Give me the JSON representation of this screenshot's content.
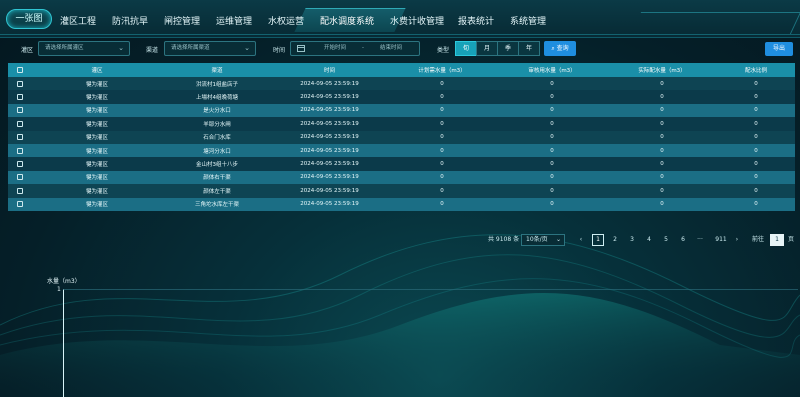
{
  "nav": {
    "home": "一张图",
    "items": [
      "灌区工程",
      "防汛抗旱",
      "闸控管理",
      "运维管理",
      "水权运营",
      "配水调度系统",
      "水费计收管理",
      "报表统计",
      "系统管理"
    ]
  },
  "filters": {
    "district_label": "灌区",
    "district_placeholder": "请选择所属灌区",
    "channel_label": "渠道",
    "channel_placeholder": "请选择所属渠道",
    "time_label": "时间",
    "start_placeholder": "开始时间",
    "range_sep": "-",
    "end_placeholder": "结束时间",
    "type_label": "类型",
    "types": [
      "旬",
      "月",
      "季",
      "年"
    ],
    "query_label": "查询",
    "export_label": "导出"
  },
  "table": {
    "headers": [
      "灌区",
      "渠道",
      "时间",
      "计划需水量（m3）",
      "审核用水量（m3）",
      "实际配水量（m3）",
      "配水比例"
    ],
    "rows": [
      [
        "犍为灌区",
        "洪流村1组盐店子",
        "2024-09-05 23:59:19",
        "0",
        "0",
        "0",
        "0"
      ],
      [
        "犍为灌区",
        "上場村4组晚荷塘",
        "2024-09-05 23:59:19",
        "0",
        "0",
        "0",
        "0"
      ],
      [
        "犍为灌区",
        "是火分水口",
        "2024-09-05 23:59:19",
        "0",
        "0",
        "0",
        "0"
      ],
      [
        "犍为灌区",
        "羊耶分水闸",
        "2024-09-05 23:59:19",
        "0",
        "0",
        "0",
        "0"
      ],
      [
        "犍为灌区",
        "石合门水库",
        "2024-09-05 23:59:19",
        "0",
        "0",
        "0",
        "0"
      ],
      [
        "犍为灌区",
        "塘河分水口",
        "2024-09-05 23:59:19",
        "0",
        "0",
        "0",
        "0"
      ],
      [
        "犍为灌区",
        "金山村3组十八步",
        "2024-09-05 23:59:19",
        "0",
        "0",
        "0",
        "0"
      ],
      [
        "犍为灌区",
        "颜体右干渠",
        "2024-09-05 23:59:19",
        "0",
        "0",
        "0",
        "0"
      ],
      [
        "犍为灌区",
        "颜体左干渠",
        "2024-09-05 23:59:19",
        "0",
        "0",
        "0",
        "0"
      ],
      [
        "犍为灌区",
        "三角坨水库左干渠",
        "2024-09-05 23:59:19",
        "0",
        "0",
        "0",
        "0"
      ]
    ]
  },
  "pager": {
    "total": "共 9108 条",
    "page_size": "10条/页",
    "prev": "‹",
    "pages": [
      "1",
      "2",
      "3",
      "4",
      "5",
      "6",
      "···",
      "911"
    ],
    "next": "›",
    "goto_label": "前往",
    "goto_value": "1",
    "page_suffix": "页"
  },
  "chart": {
    "ylabel": "水量（m3）",
    "ytick": "1"
  },
  "colors": {
    "accent": "#17a2b8",
    "button": "#1f8ee0",
    "header": "#1a8fa8"
  }
}
